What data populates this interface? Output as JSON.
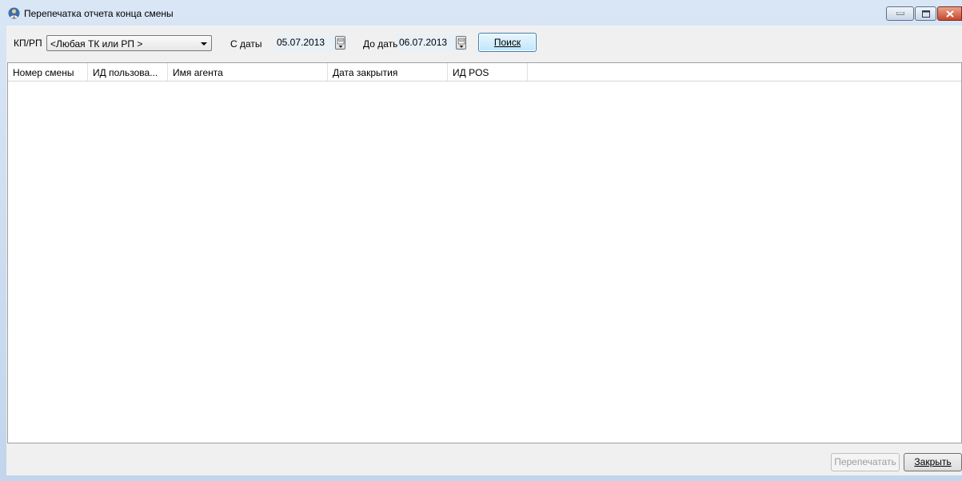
{
  "window": {
    "title": "Перепечатка отчета конца смены"
  },
  "filters": {
    "kp_label": "КП/РП",
    "kp_value": "<Любая ТК или РП >",
    "from_label": "С даты",
    "from_value": "05.07.2013",
    "to_label": "До даты",
    "to_value": "06.07.2013",
    "search_label": "Поиск"
  },
  "table": {
    "columns": [
      "Номер смены",
      "ИД пользова...",
      "Имя агента",
      "Дата закрытия",
      "ИД POS"
    ],
    "rows": []
  },
  "footer": {
    "reprint_label": "Перепечатать",
    "close_label": "Закрыть"
  },
  "icons": {
    "app": "agent-person-icon",
    "minimize": "minimize-icon",
    "maximize": "maximize-icon",
    "close": "close-icon",
    "combo_arrow": "chevron-down-icon",
    "calendar": "calendar-icon"
  }
}
